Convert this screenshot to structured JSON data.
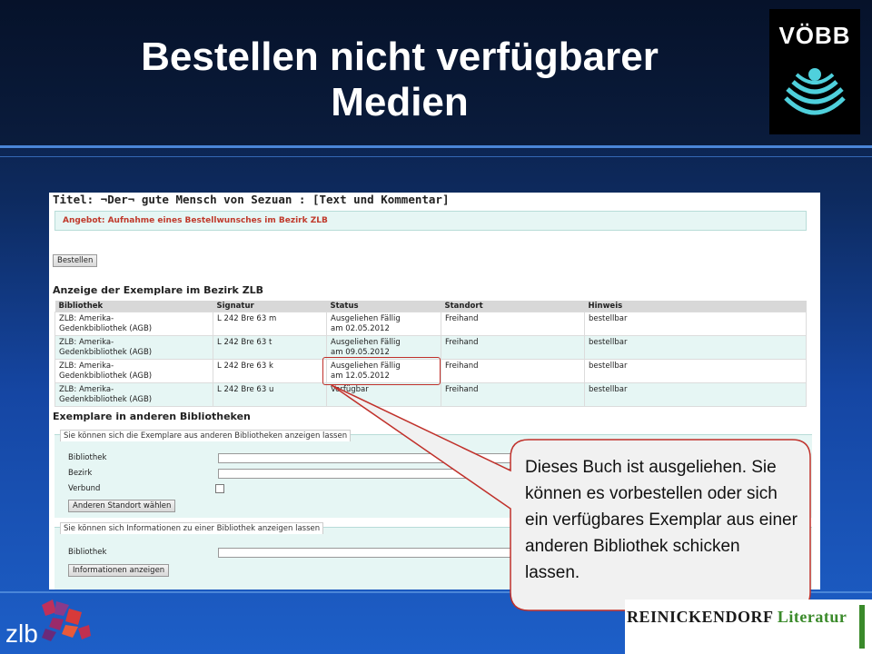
{
  "slide": {
    "title_line1": "Bestellen nicht verfügbarer",
    "title_line2": "Medien",
    "voebb_logo_text": "VÖBB",
    "zlb_logo_text": "zlb",
    "reinickendorf_part1": "REINICKENDORF",
    "reinickendorf_part2": "Literatur"
  },
  "screen": {
    "title": "Titel: ¬Der¬ gute Mensch von Sezuan : [Text und Kommentar]",
    "offer": "Angebot: Aufnahme eines Bestellwunsches im Bezirk ZLB",
    "order_button": "Bestellen",
    "copies_heading": "Anzeige der Exemplare im Bezirk ZLB",
    "columns": [
      "Bibliothek",
      "Signatur",
      "Status",
      "Standort",
      "Hinweis"
    ],
    "rows": [
      {
        "bibliothek": "ZLB: Amerika-\nGedenkbibliothek (AGB)",
        "signatur": "L 242 Bre 63 m",
        "status": "Ausgeliehen Fällig\nam 02.05.2012",
        "standort": "Freihand",
        "hinweis": "bestellbar"
      },
      {
        "bibliothek": "ZLB: Amerika-\nGedenkbibliothek (AGB)",
        "signatur": "L 242 Bre 63 t",
        "status": "Ausgeliehen Fällig\nam 09.05.2012",
        "standort": "Freihand",
        "hinweis": "bestellbar"
      },
      {
        "bibliothek": "ZLB: Amerika-\nGedenkbibliothek (AGB)",
        "signatur": "L 242 Bre 63 k",
        "status": "Ausgeliehen Fällig\nam 12.05.2012",
        "standort": "Freihand",
        "hinweis": "bestellbar"
      },
      {
        "bibliothek": "ZLB: Amerika-\nGedenkbibliothek (AGB)",
        "signatur": "L 242 Bre 63 u",
        "status": "Verfügbar",
        "standort": "Freihand",
        "hinweis": "bestellbar"
      }
    ],
    "other_heading": "Exemplare in anderen Bibliotheken",
    "fieldset1_legend": "Sie können sich die Exemplare aus anderen Bibliotheken anzeigen lassen",
    "label_bibliothek": "Bibliothek",
    "label_bezirk": "Bezirk",
    "label_verbund": "Verbund",
    "other_location_button": "Anderen Standort wählen",
    "fieldset2_legend": "Sie können sich Informationen zu einer Bibliothek anzeigen lassen",
    "label_bibliothek2": "Bibliothek",
    "info_button": "Informationen anzeigen"
  },
  "callout": {
    "text": "Dieses Buch ist ausgeliehen. Sie können es vorbestellen oder sich ein verfügbares Exemplar aus einer anderen Bibliothek schicken lassen."
  },
  "colors": {
    "accent_red": "#c0302a",
    "callout_bg": "#f1f1f1",
    "row_alt": "#e6f6f4"
  }
}
